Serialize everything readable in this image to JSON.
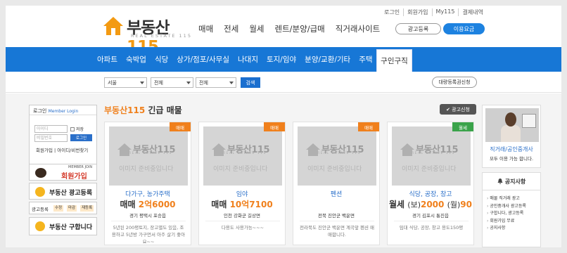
{
  "header": {
    "logo": {
      "brand_text": "부동산",
      "brand_num": "115",
      "tagline": "REAL ESTATE 115"
    },
    "top_nav": [
      "매매",
      "전세",
      "월세",
      "렌트/분양/급매",
      "직거래사이트"
    ],
    "util_links": [
      "로그인",
      "회원가입",
      "My115",
      "결제내역"
    ],
    "ad_register_button": "광고등록",
    "fee_button": "이용요금"
  },
  "category_nav": {
    "items": [
      "아파트",
      "숙박업",
      "식당",
      "상가/점포/사무실",
      "나대지",
      "토지/임야",
      "분양/교환/기타",
      "주택"
    ],
    "active": "구인구직"
  },
  "filters": {
    "region": "서울",
    "district": "전체",
    "dong": "전체",
    "search_button": "검색",
    "bulk_register_button": "대량등록권신청"
  },
  "login_box": {
    "title": "로그인",
    "title_en": "Member Login",
    "id_placeholder": "아이디",
    "pw_placeholder": "비밀번호",
    "remember_label": "저장",
    "login_button": "로그인",
    "links": "회원가입 | 아이디/비번찾기"
  },
  "left_banners": {
    "join_small": "MEMBER JOIN",
    "join_big": "회원가입",
    "ad_register": "부동산 광고등록",
    "tags_label": "광고등록",
    "tags": [
      "수정",
      "마감",
      "재등록"
    ],
    "buy": "부동산 구합니다"
  },
  "main": {
    "title_brand": "부동산115",
    "title_rest": "긴급 매물",
    "ad_request_button": "광고신청"
  },
  "placeholder_image": {
    "watermark": "부동산115",
    "sub": "REAL ESTATE 115",
    "ready": "이미지 준비중입니다"
  },
  "cards": [
    {
      "badge": "매매",
      "badge_color": "#f0801c",
      "type": "다가구, 농가주택",
      "price_prefix": "매매",
      "price_value": "2억6000",
      "price_suffix": "",
      "location": "경기 평택시 포승읍",
      "desc": "5년된 200평토지, 장고별도 있음, 조용하고 5년방 가구먼서 아주 살기 좋아요~~"
    },
    {
      "badge": "매매",
      "badge_color": "#f0801c",
      "type": "임야",
      "price_prefix": "매매",
      "price_value": "10억7100",
      "price_suffix": "",
      "location": "인천 강화군 길상면",
      "desc": "다용도 사용가능~~~"
    },
    {
      "badge": "매매",
      "badge_color": "#f0801c",
      "type": "펜션",
      "price_prefix": "",
      "price_value": "",
      "price_suffix": "",
      "location": "전북 진안군 백운면",
      "desc": "전라북도 진안군 백운면 계곡앞 펜션 매매합니다."
    },
    {
      "badge": "월세",
      "badge_color": "#3aa34a",
      "type": "식당, 공장, 창고",
      "price_prefix": "월세",
      "price_value": "2000",
      "price_paren_open": "(보)",
      "price_paren_close": "(월)",
      "price_suffix": "90",
      "location": "경기 김포시 통진읍",
      "desc": "임대 식당, 공장, 창고 용도150평"
    }
  ],
  "promo": {
    "title": "직거래/공인중개사",
    "subtitle": "모두 이용 가능 합니다."
  },
  "notice": {
    "title": "공지사항",
    "items": [
      "매물 직거래 광고",
      "공인중개사 광고등록",
      "구합니다, 광고등록",
      "회원가입 무료",
      "공지사항"
    ]
  }
}
